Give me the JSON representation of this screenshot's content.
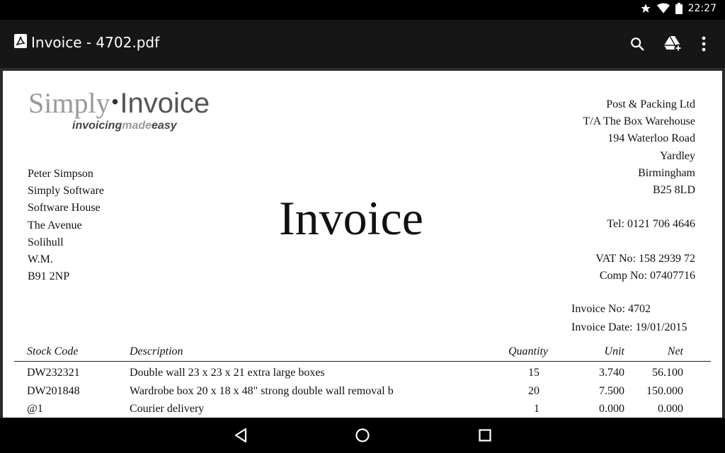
{
  "status_bar": {
    "time": "22:27"
  },
  "app_bar": {
    "title": "Invoice - 4702.pdf",
    "actions": [
      "search-icon",
      "drive-add-icon",
      "more-vert-icon"
    ]
  },
  "invoice": {
    "logo": {
      "simply": "Simply",
      "invoice": "Invoice",
      "tag_invoicing": "invoicing",
      "tag_made": "made",
      "tag_easy": "easy"
    },
    "customer_address": [
      "Peter Simpson",
      "Simply Software",
      "Software House",
      "The Avenue",
      "Solihull",
      "W.M.",
      "B91 2NP"
    ],
    "heading": "Invoice",
    "seller": {
      "lines": [
        "Post & Packing Ltd",
        "T/A The Box Warehouse",
        "194 Waterloo Road",
        "Yardley",
        "Birmingham",
        "B25 8LD"
      ],
      "tel": "Tel: 0121 706 4646",
      "vat": "VAT No: 158 2939 72",
      "comp": "Comp No: 07407716"
    },
    "invoice_no": "Invoice No: 4702",
    "invoice_date": "Invoice Date: 19/01/2015",
    "columns": {
      "stock_code": "Stock Code",
      "description": "Description",
      "quantity": "Quantity",
      "unit": "Unit",
      "net": "Net"
    },
    "rows": [
      {
        "code": "DW232321",
        "desc": "Double wall 23 x 23 x 21 extra large boxes",
        "qty": "15",
        "unit": "3.740",
        "net": "56.100"
      },
      {
        "code": "DW201848",
        "desc": "Wardrobe box 20 x 18 x 48\" strong double wall removal b",
        "qty": "20",
        "unit": "7.500",
        "net": "150.000"
      },
      {
        "code": "@1",
        "desc": "Courier delivery",
        "qty": "1",
        "unit": "0.000",
        "net": "0.000"
      }
    ]
  },
  "nav_bar": {
    "buttons": [
      "back-icon",
      "home-icon",
      "recents-icon"
    ]
  }
}
